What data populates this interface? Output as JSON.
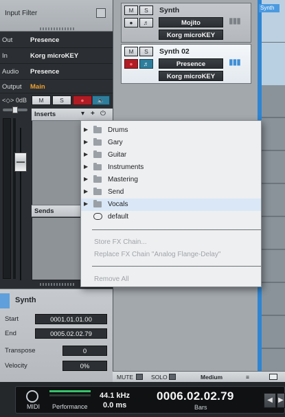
{
  "inspector": {
    "input_filter": "Input Filter",
    "rows": [
      {
        "key": "Out",
        "value": "Presence"
      },
      {
        "key": "In",
        "value": "Korg microKEY"
      },
      {
        "key": "Audio",
        "value": "Presence"
      },
      {
        "key": "Output",
        "value": "Main"
      }
    ],
    "volume": "0dB",
    "mute": "M",
    "solo": "S",
    "inserts": "Inserts",
    "sends": "Sends",
    "track_name": "Synth",
    "start_label": "Start",
    "start_value": "0001.01.01.00",
    "end_label": "End",
    "end_value": "0005.02.02.79",
    "transpose_label": "Transpose",
    "transpose_value": "0",
    "velocity_label": "Velocity",
    "velocity_value": "0%"
  },
  "tracks": [
    {
      "mute": "M",
      "solo": "S",
      "name": "Synth",
      "slot1": "Mojito",
      "slot2": "Korg microKEY"
    },
    {
      "mute": "M",
      "solo": "S",
      "name": "Synth 02",
      "slot1": "Presence",
      "slot2": "Korg microKEY"
    }
  ],
  "lane_label": "Synth",
  "bottom_bar": {
    "mute": "MUTE",
    "solo": "SOLO",
    "zoom": "Medium"
  },
  "menu": {
    "folders": [
      "Drums",
      "Gary",
      "Guitar",
      "Instruments",
      "Mastering",
      "Send",
      "Vocals"
    ],
    "default": "default",
    "store": "Store FX Chain...",
    "replace": "Replace FX Chain \"Analog Flange-Delay\"",
    "remove": "Remove All"
  },
  "transport": {
    "midi": "MIDI",
    "performance": "Performance",
    "sample_rate": "44.1 kHz",
    "latency": "0.0 ms",
    "timecode": "0006.02.02.79",
    "unit": "Bars"
  },
  "colors": {
    "accent_blue": "#2e85d2",
    "record_red": "#b01c24",
    "monitor_teal": "#2e7d9b",
    "output_orange": "#f0a030"
  }
}
